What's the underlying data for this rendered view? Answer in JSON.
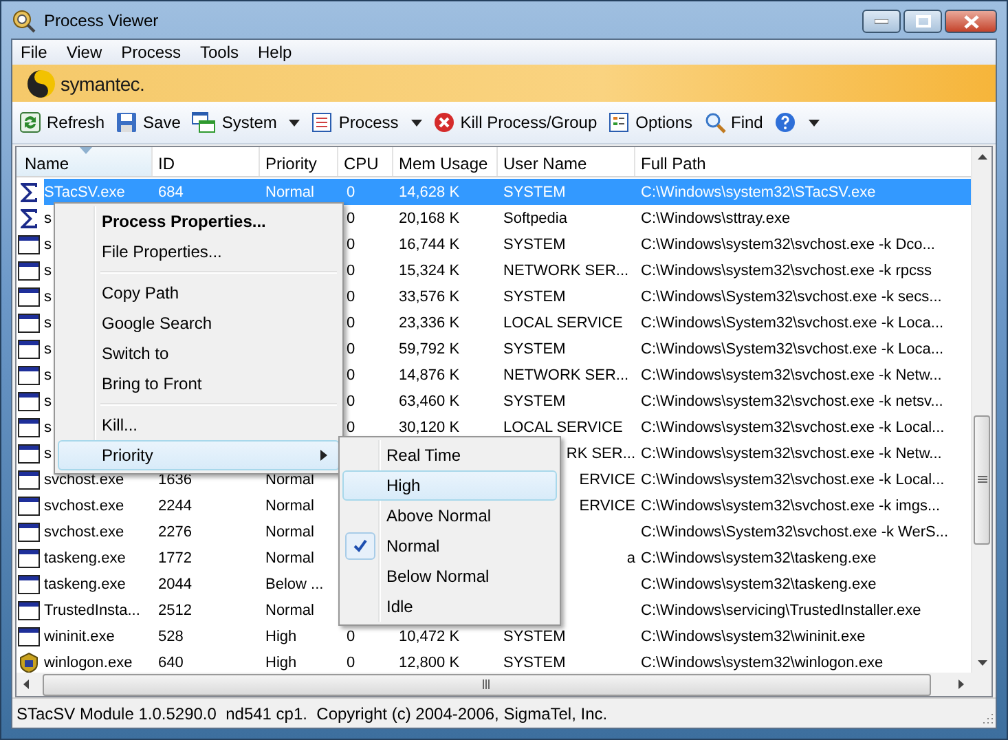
{
  "window": {
    "title": "Process Viewer"
  },
  "menu_bar": [
    "File",
    "View",
    "Process",
    "Tools",
    "Help"
  ],
  "banner": {
    "logo_text": "symantec."
  },
  "toolbar": [
    {
      "label": "Refresh",
      "dropdown": false
    },
    {
      "label": "Save",
      "dropdown": false
    },
    {
      "label": "System",
      "dropdown": true
    },
    {
      "label": "Process",
      "dropdown": true
    },
    {
      "label": "Kill Process/Group",
      "dropdown": false
    },
    {
      "label": "Options",
      "dropdown": false
    },
    {
      "label": "Find",
      "dropdown": false
    },
    {
      "dropdown": true
    }
  ],
  "table": {
    "columns": [
      {
        "label": "Name",
        "sorted": true
      },
      {
        "label": "ID",
        "sorted": false
      },
      {
        "label": "Priority",
        "sorted": false
      },
      {
        "label": "CPU",
        "sorted": false
      },
      {
        "label": "Mem Usage",
        "sorted": false
      },
      {
        "label": "User Name",
        "sorted": false
      },
      {
        "label": "Full Path",
        "sorted": false
      }
    ],
    "rows": [
      {
        "kind": "sigma",
        "selected": true,
        "cells": [
          "STacSV.exe",
          "684",
          "Normal",
          "0",
          "14,628 K",
          "SYSTEM",
          "C:\\Windows\\system32\\STacSV.exe"
        ]
      },
      {
        "kind": "sigma",
        "selected": false,
        "cells": [
          "s",
          null,
          null,
          "0",
          "20,168 K",
          "Softpedia",
          "C:\\Windows\\sttray.exe"
        ]
      },
      {
        "kind": "window",
        "selected": false,
        "cells": [
          "s",
          null,
          null,
          "0",
          "16,744 K",
          "SYSTEM",
          "C:\\Windows\\system32\\svchost.exe -k Dco..."
        ]
      },
      {
        "kind": "window",
        "selected": false,
        "cells": [
          "s",
          null,
          null,
          "0",
          "15,324 K",
          "NETWORK SER...",
          "C:\\Windows\\system32\\svchost.exe -k rpcss"
        ]
      },
      {
        "kind": "window",
        "selected": false,
        "cells": [
          "s",
          null,
          null,
          "0",
          "33,576 K",
          "SYSTEM",
          "C:\\Windows\\System32\\svchost.exe -k secs..."
        ]
      },
      {
        "kind": "window",
        "selected": false,
        "cells": [
          "s",
          null,
          null,
          "0",
          "23,336 K",
          "LOCAL SERVICE",
          "C:\\Windows\\System32\\svchost.exe -k Loca..."
        ]
      },
      {
        "kind": "window",
        "selected": false,
        "cells": [
          "s",
          null,
          null,
          "0",
          "59,792 K",
          "SYSTEM",
          "C:\\Windows\\System32\\svchost.exe -k Loca..."
        ]
      },
      {
        "kind": "window",
        "selected": false,
        "cells": [
          "s",
          null,
          null,
          "0",
          "14,876 K",
          "NETWORK SER...",
          "C:\\Windows\\system32\\svchost.exe -k Netw..."
        ]
      },
      {
        "kind": "window",
        "selected": false,
        "cells": [
          "s",
          null,
          null,
          "0",
          "63,460 K",
          "SYSTEM",
          "C:\\Windows\\system32\\svchost.exe -k netsv..."
        ]
      },
      {
        "kind": "window",
        "selected": false,
        "cells": [
          "s",
          null,
          null,
          "0",
          "30,120 K",
          "LOCAL SERVICE",
          "C:\\Windows\\system32\\svchost.exe -k Local..."
        ]
      },
      {
        "kind": "window",
        "selected": false,
        "user_name_clipped": true,
        "cells": [
          "s",
          null,
          null,
          null,
          null,
          "RK SER...",
          "C:\\Windows\\system32\\svchost.exe -k Netw..."
        ]
      },
      {
        "kind": "window",
        "selected": false,
        "user_name_clipped": true,
        "cells": [
          "svchost.exe",
          "1636",
          "Normal",
          null,
          null,
          "ERVICE",
          "C:\\Windows\\system32\\svchost.exe -k Local..."
        ]
      },
      {
        "kind": "window",
        "selected": false,
        "user_name_clipped": true,
        "cells": [
          "svchost.exe",
          "2244",
          "Normal",
          null,
          null,
          "ERVICE",
          "C:\\Windows\\system32\\svchost.exe -k imgs..."
        ]
      },
      {
        "kind": "window",
        "selected": false,
        "cells": [
          "svchost.exe",
          "2276",
          "Normal",
          null,
          null,
          null,
          "C:\\Windows\\System32\\svchost.exe -k WerS..."
        ]
      },
      {
        "kind": "window",
        "selected": false,
        "user_name_clipped": true,
        "cells": [
          "taskeng.exe",
          "1772",
          "Normal",
          null,
          null,
          "a",
          "C:\\Windows\\system32\\taskeng.exe"
        ]
      },
      {
        "kind": "window",
        "selected": false,
        "cells": [
          "taskeng.exe",
          "2044",
          "Below ...",
          null,
          null,
          null,
          "C:\\Windows\\system32\\taskeng.exe"
        ]
      },
      {
        "kind": "window",
        "selected": false,
        "cells": [
          "TrustedInsta...",
          "2512",
          "Normal",
          null,
          null,
          null,
          "C:\\Windows\\servicing\\TrustedInstaller.exe"
        ]
      },
      {
        "kind": "window",
        "selected": false,
        "cells": [
          "wininit.exe",
          "528",
          "High",
          "0",
          "10,472 K",
          "SYSTEM",
          "C:\\Windows\\system32\\wininit.exe"
        ]
      },
      {
        "kind": "shield",
        "selected": false,
        "cells": [
          "winlogon.exe",
          "640",
          "High",
          "0",
          "12,800 K",
          "SYSTEM",
          "C:\\Windows\\system32\\winlogon.exe"
        ]
      }
    ]
  },
  "context_menu": [
    {
      "kind": "item",
      "label": "Process Properties...",
      "default": true,
      "selected": false,
      "submenu": false
    },
    {
      "kind": "item",
      "label": "File Properties...",
      "default": false,
      "selected": false,
      "submenu": false
    },
    {
      "kind": "separator"
    },
    {
      "kind": "item",
      "label": "Copy Path",
      "default": false,
      "selected": false,
      "submenu": false
    },
    {
      "kind": "item",
      "label": "Google Search",
      "default": false,
      "selected": false,
      "submenu": false
    },
    {
      "kind": "item",
      "label": "Switch to",
      "default": false,
      "selected": false,
      "submenu": false
    },
    {
      "kind": "item",
      "label": "Bring to Front",
      "default": false,
      "selected": false,
      "submenu": false
    },
    {
      "kind": "separator"
    },
    {
      "kind": "item",
      "label": "Kill...",
      "default": false,
      "selected": false,
      "submenu": false
    },
    {
      "kind": "item",
      "label": "Priority",
      "default": false,
      "selected": true,
      "submenu": true
    }
  ],
  "priority_submenu": [
    {
      "label": "Real Time",
      "selected": false,
      "checked": false
    },
    {
      "label": "High",
      "selected": true,
      "checked": false
    },
    {
      "label": "Above Normal",
      "selected": false,
      "checked": false
    },
    {
      "label": "Normal",
      "selected": false,
      "checked": true
    },
    {
      "label": "Below Normal",
      "selected": false,
      "checked": false
    },
    {
      "label": "Idle",
      "selected": false,
      "checked": false
    }
  ],
  "status_bar": "STacSV Module 1.0.5290.0  nd541 cp1.  Copyright (c) 2004-2006, SigmaTel, Inc."
}
